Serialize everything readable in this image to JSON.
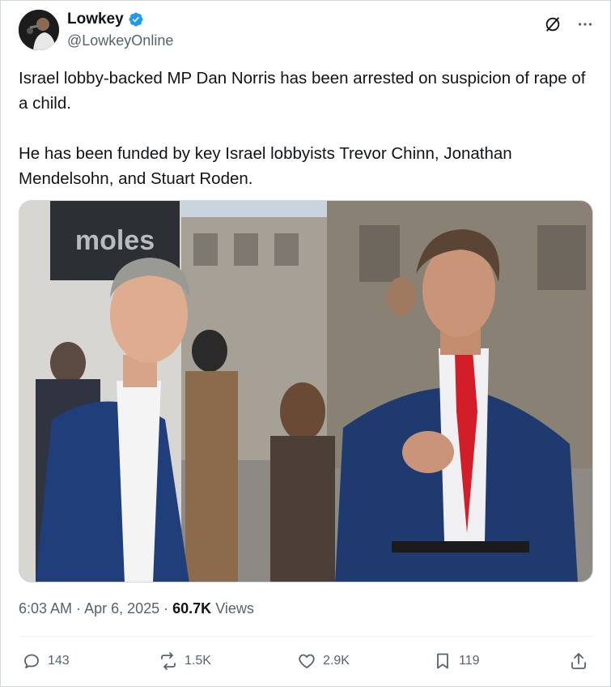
{
  "author": {
    "name": "Lowkey",
    "handle": "@LowkeyOnline",
    "verified": true,
    "verified_color": "#1d9bf0"
  },
  "tweet": {
    "paragraphs": [
      "Israel lobby-backed MP Dan Norris has been arrested on suspicion of rape of a child.",
      "He has been funded by key Israel lobbyists Trevor Chinn, Jonathan Mendelsohn, and Stuart Roden."
    ]
  },
  "media": {
    "sign_text": "moles"
  },
  "meta": {
    "time": "6:03 AM",
    "separator1": " · ",
    "date": "Apr 6, 2025",
    "separator2": " · ",
    "views_count": "60.7K",
    "views_label": " Views"
  },
  "actions": {
    "replies": "143",
    "reposts": "1.5K",
    "likes": "2.9K",
    "bookmarks": "119"
  },
  "icons": {
    "x_logo": "x-logo-icon",
    "more": "more-icon",
    "reply": "reply-icon",
    "repost": "repost-icon",
    "like": "heart-icon",
    "bookmark": "bookmark-icon",
    "share": "share-icon"
  }
}
